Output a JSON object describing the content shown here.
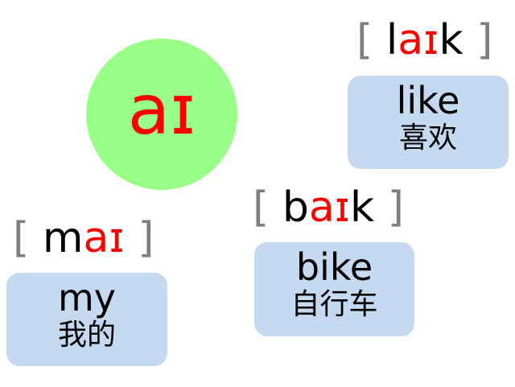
{
  "title_symbol": "aɪ",
  "colors": {
    "circle": "#99ff88",
    "highlight": "#ff0000",
    "bracket": "#7f7f7f",
    "card": "#c5d9f0"
  },
  "words": [
    {
      "bracket_open": "[",
      "phonetic_pre": "l",
      "phonetic_hl": "aɪ",
      "phonetic_post": "k",
      "bracket_close": "]",
      "word": "like",
      "meaning": "喜欢"
    },
    {
      "bracket_open": "[",
      "phonetic_pre": "b",
      "phonetic_hl": "aɪ",
      "phonetic_post": "k",
      "bracket_close": "]",
      "word": "bike",
      "meaning": "自行车"
    },
    {
      "bracket_open": "[",
      "phonetic_pre": "m",
      "phonetic_hl": "aɪ",
      "phonetic_post": "",
      "bracket_close": "]",
      "word": "my",
      "meaning": "我的"
    }
  ]
}
